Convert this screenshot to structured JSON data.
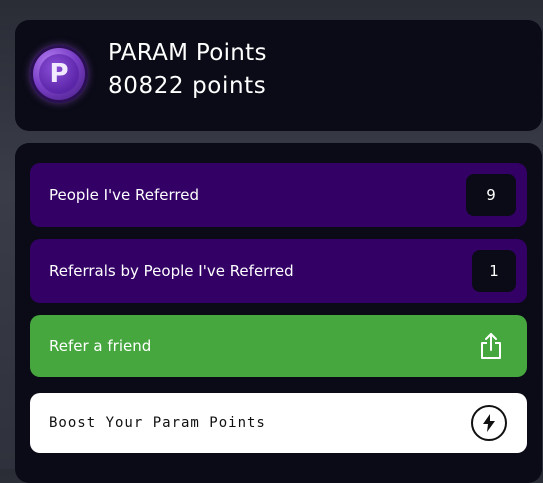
{
  "header": {
    "title": "PARAM Points",
    "points": "80822 points",
    "logo_letter": "P"
  },
  "stats": [
    {
      "label": "People I've Referred",
      "value": "9"
    },
    {
      "label": "Referrals by People I've Referred",
      "value": "1"
    }
  ],
  "actions": {
    "refer_label": "Refer a friend",
    "refer_icon": "share-icon",
    "boost_label": "Boost Your Param Points",
    "boost_icon": "lightning-icon"
  },
  "colors": {
    "referral_row": "#330065",
    "refer_button": "#45a73e",
    "card_bg": "#0b0b17"
  }
}
